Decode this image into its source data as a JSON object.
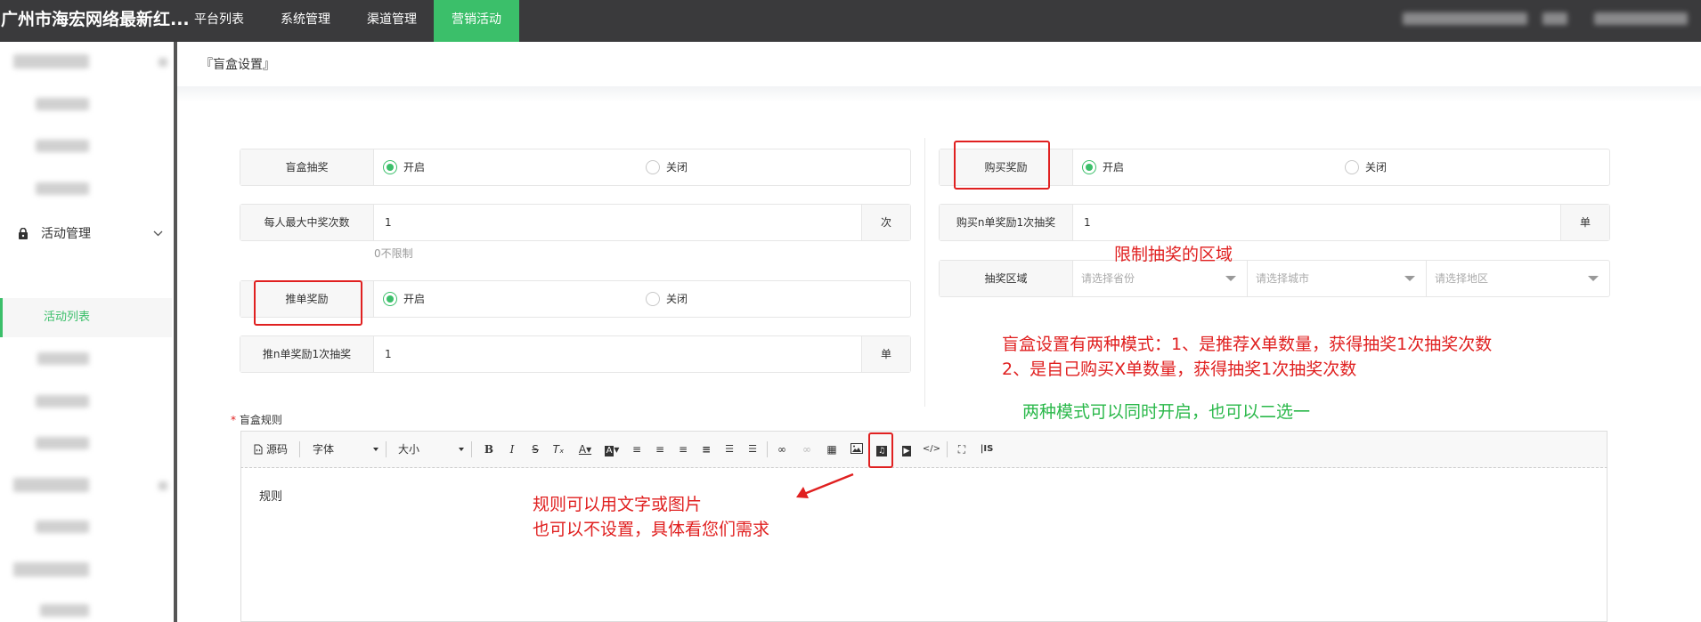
{
  "topbar": {
    "brand": "广州市海宏网络最新红...",
    "nav": [
      "平台列表",
      "系统管理",
      "渠道管理",
      "营销活动"
    ]
  },
  "sidebar": {
    "menu_label": "活动管理",
    "active_sub": "活动列表"
  },
  "breadcrumb": "『盲盒设置』",
  "form": {
    "blindbox": {
      "label": "盲盒抽奖",
      "on": "开启",
      "off": "关闭"
    },
    "maxwin": {
      "label": "每人最大中奖次数",
      "value": "1",
      "unit": "次",
      "hint": "0不限制"
    },
    "referral": {
      "label": "推单奖励",
      "on": "开启",
      "off": "关闭"
    },
    "refcount": {
      "label": "推n单奖励1次抽奖",
      "value": "1",
      "unit": "单"
    },
    "purchase": {
      "label": "购买奖励",
      "on": "开启",
      "off": "关闭"
    },
    "buycount": {
      "label": "购买n单奖励1次抽奖",
      "value": "1",
      "unit": "单"
    },
    "region": {
      "label": "抽奖区域",
      "province": "请选择省份",
      "city": "请选择城市",
      "district": "请选择地区"
    },
    "rules_label": "盲盒规则",
    "rules_required": "*"
  },
  "toolbar": {
    "source": "源码",
    "font": "字体",
    "size": "大小"
  },
  "editor": {
    "content": "规则"
  },
  "annotations": {
    "region": "限制抽奖的区域",
    "modes_line1": "盲盒设置有两种模式：1、是推荐X单数量，获得抽奖1次抽奖次数",
    "modes_line2": "2、是自己购买X单数量，获得抽奖1次抽奖次数",
    "both": "两种模式可以同时开启，也可以二选一",
    "rules_line1": "规则可以用文字或图片",
    "rules_line2": "也可以不设置，具体看您们需求"
  },
  "colors": {
    "accent": "#3bbf6a",
    "annotation_red": "#e02020",
    "annotation_green": "#2ab84a",
    "topbar": "#3a3a3c"
  }
}
